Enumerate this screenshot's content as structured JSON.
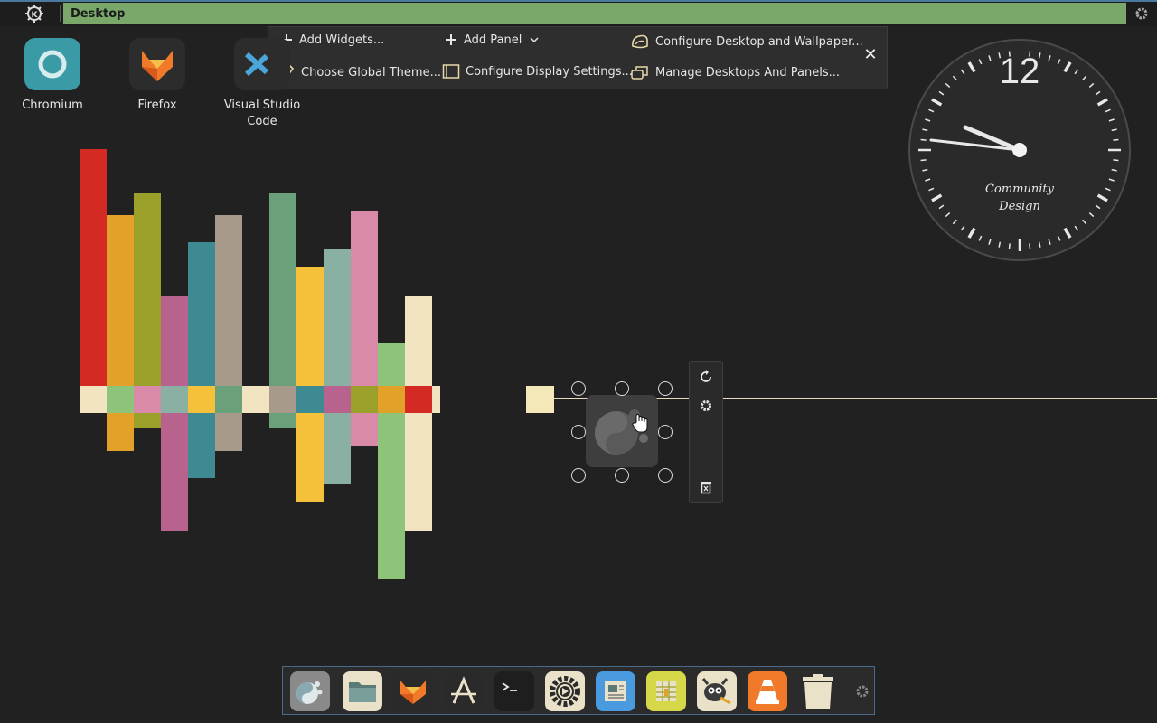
{
  "top_panel": {
    "title": "Desktop",
    "logo_icon": "kde-logo-icon",
    "settings_icon": "gear-icon",
    "accent": "#7aa86a"
  },
  "edit_toolbar": {
    "add_widgets": "Add Widgets...",
    "add_panel": "Add Panel",
    "configure_desktop": "Configure Desktop and Wallpaper...",
    "choose_theme": "Choose Global Theme...",
    "configure_display": "Configure Display Settings...",
    "manage_desktops": "Manage Desktops And Panels...",
    "close_glyph": "✕"
  },
  "desktop_icons": [
    {
      "label": "Chromium",
      "icon": "chromium-icon"
    },
    {
      "label": "Firefox",
      "icon": "firefox-icon"
    },
    {
      "label": "Visual Studio Code",
      "icon": "vscode-icon"
    }
  ],
  "clock": {
    "numeral": "12",
    "text_line1": "Community",
    "text_line2": "Design",
    "time_shown": "9:47"
  },
  "widget": {
    "icon": "plasma-logo-icon",
    "controls": [
      "rotate-icon",
      "settings-icon",
      "remove-icon"
    ]
  },
  "dock": {
    "items": [
      {
        "name": "plasma-launcher-icon",
        "bg": "#8a8a8a"
      },
      {
        "name": "file-manager-icon",
        "bg": "#e9e2c8"
      },
      {
        "name": "firefox-icon",
        "bg": "#2a2a2a"
      },
      {
        "name": "text-editor-icon",
        "bg": "#2a2a2a"
      },
      {
        "name": "terminal-icon",
        "bg": "#1e1e1e"
      },
      {
        "name": "system-settings-icon",
        "bg": "#e9e2c8"
      },
      {
        "name": "document-viewer-icon",
        "bg": "#4a9ae0"
      },
      {
        "name": "spreadsheet-icon",
        "bg": "#d6d84a"
      },
      {
        "name": "gimp-icon",
        "bg": "#e9e2c8"
      },
      {
        "name": "vlc-icon",
        "bg": "#f07a2a"
      },
      {
        "name": "trash-icon",
        "bg": "#e9e2c8"
      }
    ],
    "settings_icon": "gear-icon"
  }
}
